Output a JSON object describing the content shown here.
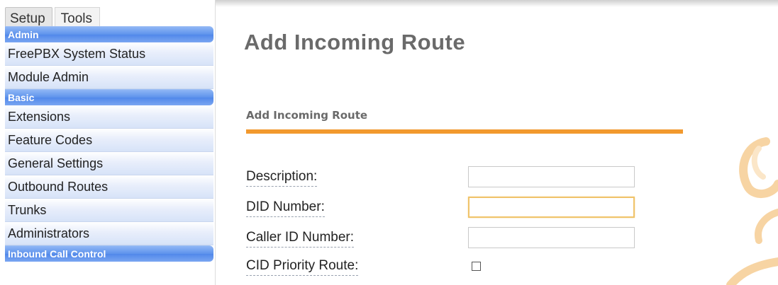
{
  "tabs": [
    {
      "label": "Setup",
      "active": true
    },
    {
      "label": "Tools",
      "active": false
    }
  ],
  "sidebar": {
    "sections": [
      {
        "title": "Admin",
        "items": [
          "FreePBX System Status",
          "Module Admin"
        ]
      },
      {
        "title": "Basic",
        "items": [
          "Extensions",
          "Feature Codes",
          "General Settings",
          "Outbound Routes",
          "Trunks",
          "Administrators"
        ]
      },
      {
        "title": "Inbound Call Control",
        "items": []
      }
    ]
  },
  "main": {
    "title": "Add Incoming Route",
    "section_heading": "Add Incoming Route",
    "fields": [
      {
        "label": "Description:",
        "type": "text",
        "value": ""
      },
      {
        "label": "DID Number:",
        "type": "text",
        "value": "",
        "focused": true
      },
      {
        "label": "Caller ID Number:",
        "type": "text",
        "value": ""
      },
      {
        "label": "CID Priority Route:",
        "type": "checkbox",
        "checked": false
      }
    ]
  },
  "colors": {
    "accent_orange": "#f2992e",
    "menu_header_blue": "#5d92ec",
    "title_gray": "#6a6a6a"
  }
}
